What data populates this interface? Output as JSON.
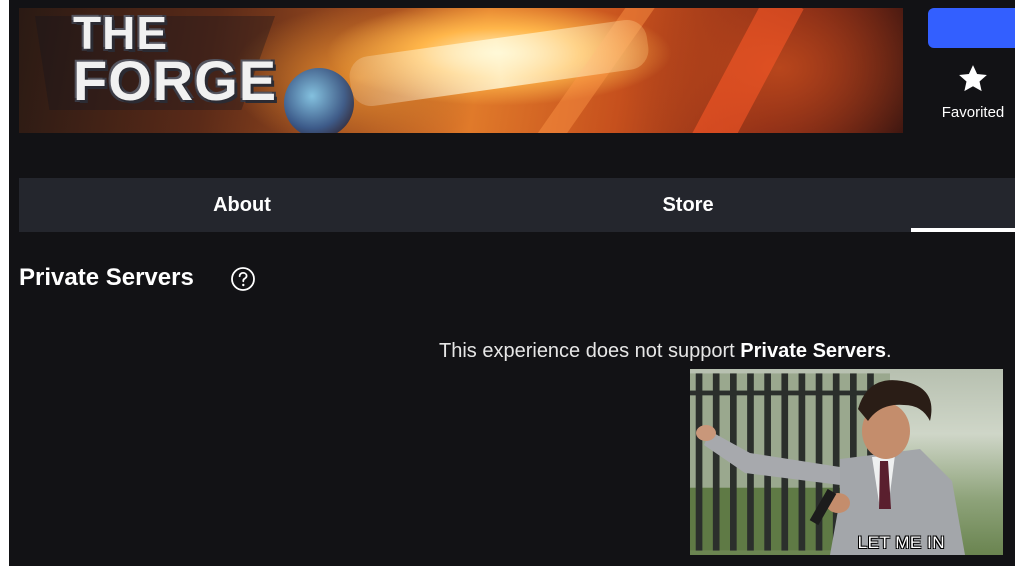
{
  "banner": {
    "logo_line1": "THE",
    "logo_line2": "FORGE"
  },
  "favorite": {
    "icon": "star-icon",
    "label": "Favorited"
  },
  "tabs": [
    {
      "label": "About",
      "active": false
    },
    {
      "label": "Store",
      "active": false
    },
    {
      "label": "",
      "active": true
    }
  ],
  "private_servers": {
    "title": "Private Servers",
    "help_icon": "help-circle-icon",
    "message_prefix": "This experience does not support ",
    "message_highlight": "Private Servers",
    "message_suffix": "."
  },
  "meme": {
    "caption": "LET ME IN"
  },
  "colors": {
    "background": "#121215",
    "tab_bar": "#24262d",
    "accent_button": "#335fff",
    "text": "#ffffff"
  }
}
